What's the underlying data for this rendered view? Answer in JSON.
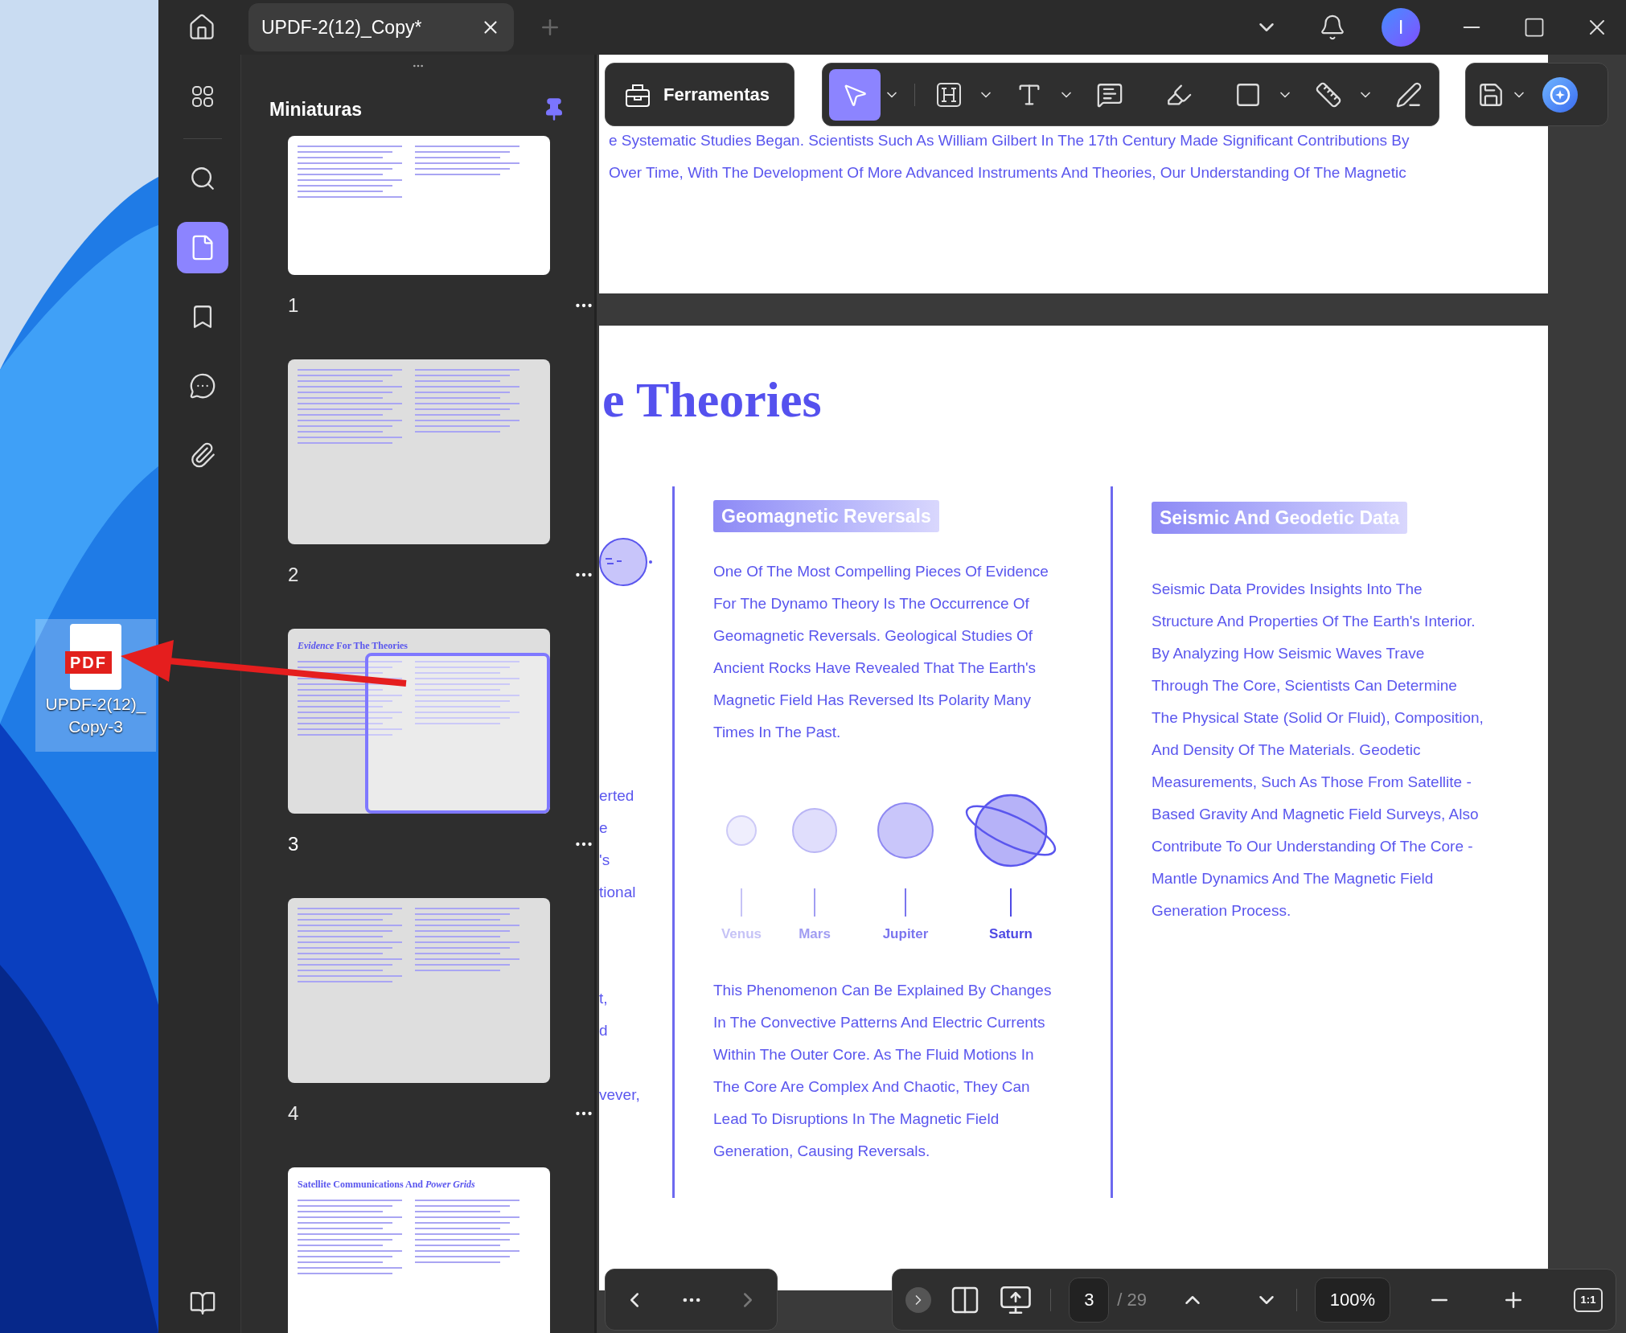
{
  "window": {
    "tab": {
      "title": "UPDF-2(12)_Copy*",
      "selected": true
    },
    "avatar_initial": "I"
  },
  "sidebar": {
    "items": [
      {
        "selected": false
      },
      {
        "selected": false
      },
      {
        "selected": true
      },
      {
        "selected": false
      },
      {
        "selected": false
      },
      {
        "selected": false
      }
    ]
  },
  "thumbnails": {
    "title": "Miniaturas",
    "pinned": true,
    "pages": [
      {
        "number": "1",
        "selected": false
      },
      {
        "number": "2",
        "selected": false
      },
      {
        "number": "3",
        "selected": true,
        "title": "*Evidence* For The Theories"
      },
      {
        "number": "4",
        "selected": false
      },
      {
        "selected": false,
        "title": "Satellite Communications And *Power Grids*"
      }
    ]
  },
  "toolbar": {
    "tools_label": "Ferramentas",
    "tools": [
      {
        "selected": true,
        "dropdown": true
      },
      {
        "selected": false,
        "dropdown": true
      },
      {
        "selected": false,
        "dropdown": true
      },
      {
        "selected": false,
        "dropdown": false
      },
      {
        "selected": false,
        "dropdown": false
      },
      {
        "selected": false,
        "dropdown": true
      },
      {
        "selected": false,
        "dropdown": true
      },
      {
        "selected": false,
        "dropdown": false
      }
    ]
  },
  "document": {
    "page1_lines": [
      "e Systematic Studies Began. Scientists Such As William Gilbert In The 17th Century Made Significant Contributions By",
      "Over Time, With The Development Of More Advanced Instruments And Theories, Our Understanding Of The Magnetic"
    ],
    "heading": "e Theories",
    "fragments": [
      "erted",
      "e",
      "'s",
      "tional",
      "t,",
      "d",
      "vever,"
    ],
    "column_1": {
      "badge": "Geomagnetic Reversals",
      "paragraph_1": [
        "One Of The Most Compelling Pieces Of Evidence",
        "For The Dynamo Theory Is The Occurrence Of",
        "Geomagnetic Reversals. Geological Studies Of",
        "Ancient Rocks Have Revealed That The Earth's",
        "Magnetic Field Has Reversed Its Polarity Many",
        "Times In The Past."
      ],
      "planets": [
        {
          "name": "Venus",
          "color": "#c6c3f6"
        },
        {
          "name": "Mars",
          "color": "#a19df2"
        },
        {
          "name": "Jupiter",
          "color": "#7a75ee"
        },
        {
          "name": "Saturn",
          "color": "#4e49e4"
        }
      ],
      "paragraph_2": [
        "This Phenomenon Can Be Explained By Changes",
        "In The Convective Patterns And Electric Currents",
        "Within The Outer Core. As The Fluid Motions In",
        "The Core Are Complex And Chaotic, They Can",
        "Lead To Disruptions In The Magnetic Field",
        "Generation, Causing Reversals."
      ]
    },
    "column_2": {
      "badge": "Seismic And Geodetic Data",
      "paragraph": [
        "Seismic Data Provides Insights Into The",
        "Structure And Properties Of The Earth's Interior.",
        "By Analyzing How Seismic Waves Trave",
        "Through The Core, Scientists Can Determine",
        "The Physical State (Solid Or Fluid), Composition,",
        "And Density Of The Materials. Geodetic",
        "Measurements, Such As Those From Satellite -",
        "Based Gravity And Magnetic Field Surveys, Also",
        "Contribute To Our Understanding Of The Core -",
        "Mantle Dynamics And The Magnetic Field",
        "Generation Process."
      ]
    }
  },
  "bottom_bar": {
    "prev": {
      "disabled": false
    },
    "next": {
      "disabled": true
    },
    "page": "3",
    "total": "/ 29",
    "zoom": "100%",
    "actual_size": "1:1"
  },
  "desktop_icon": {
    "badge": "PDF",
    "label_lines": [
      "UPDF-2(12)_",
      "Copy-3"
    ],
    "selected": true
  }
}
